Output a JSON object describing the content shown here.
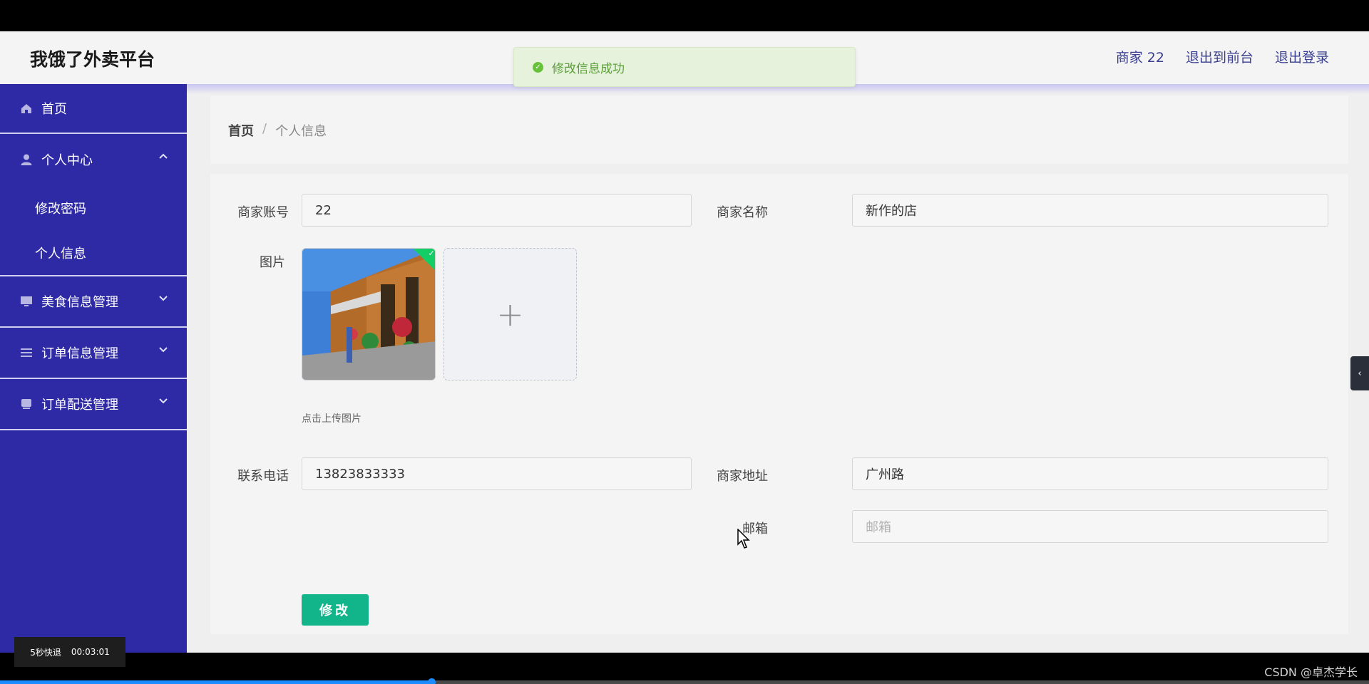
{
  "header": {
    "brand": "我饿了外卖平台",
    "user": "商家 22",
    "to_front": "退出到前台",
    "logout": "退出登录"
  },
  "toast": {
    "message": "修改信息成功",
    "color": "#67c23a"
  },
  "sidebar": {
    "home": "首页",
    "personal_center": "个人中心",
    "change_password": "修改密码",
    "personal_info": "个人信息",
    "food_mgmt": "美食信息管理",
    "order_mgmt": "订单信息管理",
    "delivery_mgmt": "订单配送管理",
    "bg_color": "#2e29a4"
  },
  "breadcrumb": {
    "home": "首页",
    "separator": "/",
    "current": "个人信息"
  },
  "form": {
    "account_label": "商家账号",
    "account_value": "22",
    "name_label": "商家名称",
    "name_value": "新作的店",
    "image_label": "图片",
    "upload_tip": "点击上传图片",
    "phone_label": "联系电话",
    "phone_value": "13823833333",
    "address_label": "商家地址",
    "address_value": "广州路",
    "email_label": "邮箱",
    "email_placeholder": "邮箱",
    "submit": "修改",
    "submit_color": "#12b48a"
  },
  "video": {
    "rewind": "5秒快退",
    "time": "00:03:01",
    "progress": 0.315,
    "watermark": "CSDN @卓杰学长"
  }
}
